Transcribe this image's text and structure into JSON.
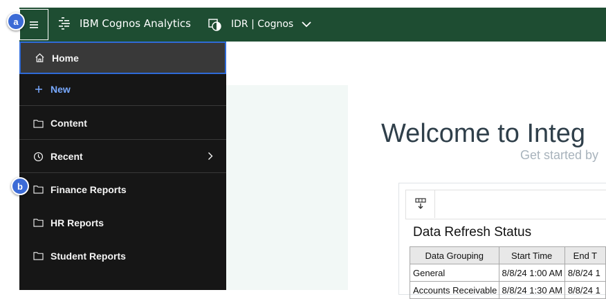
{
  "header": {
    "app_name": "IBM Cognos Analytics",
    "context_name": "IDR | Cognos"
  },
  "annotations": {
    "a": "a",
    "b": "b"
  },
  "sidebar": {
    "items": [
      {
        "label": "Home",
        "icon": "home-icon"
      },
      {
        "label": "New",
        "icon": "plus-icon"
      },
      {
        "label": "Content",
        "icon": "folder-icon"
      },
      {
        "label": "Recent",
        "icon": "clock-icon"
      },
      {
        "label": "Finance Reports",
        "icon": "folder-icon"
      },
      {
        "label": "HR Reports",
        "icon": "folder-icon"
      },
      {
        "label": "Student Reports",
        "icon": "folder-icon"
      }
    ]
  },
  "main": {
    "welcome": "Welcome to Integ",
    "subtitle": "Get started by",
    "report": {
      "title": "Data Refresh Status",
      "columns": [
        "Data Grouping",
        "Start Time",
        "End T"
      ],
      "rows": [
        [
          "General",
          "8/8/24 1:00 AM",
          "8/8/24 1"
        ],
        [
          "Accounts Receivable",
          "8/8/24 1:30 AM",
          "8/8/24 1"
        ]
      ]
    }
  },
  "colors": {
    "topbar": "#1e4d32",
    "sidebar": "#161616",
    "accent_blue": "#2f6bd8",
    "new_link": "#78a9ff"
  }
}
